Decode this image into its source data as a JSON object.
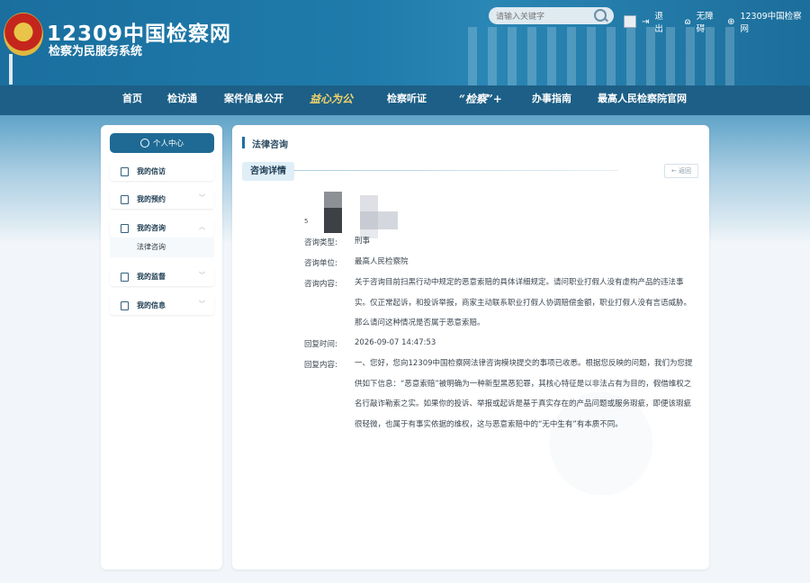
{
  "header": {
    "logo_title": "12309中国检察网",
    "logo_subtitle": "检察为民服务系统",
    "search_placeholder": "请输入关键字",
    "logout": "退出",
    "accessibility": "无障碍",
    "site_link": "12309中国检察网"
  },
  "nav": {
    "items": [
      "首页",
      "检访通",
      "案件信息公开",
      "益心为公",
      "检察听证",
      "“检察”+",
      "办事指南",
      "最高人民检察院官网"
    ]
  },
  "sidebar": {
    "personal_center": "个人中心",
    "menus": [
      "我的信访",
      "我的预约",
      "我的咨询",
      "我的监督",
      "我的信息"
    ],
    "submenu": "法律咨询"
  },
  "main": {
    "breadcrumb": "法律咨询",
    "tab": "咨询详情",
    "back": "← 返回",
    "name_fragment": "5",
    "fields": [
      {
        "label": "咨询类型:",
        "value": "刑事"
      },
      {
        "label": "咨询单位:",
        "value": "最高人民检察院"
      },
      {
        "label": "咨询内容:",
        "value": "关于咨询目前扫黑行动中规定的恶意索赔的具体详细规定。请问职业打假人没有虚构产品的违法事实。仅正常起诉，和投诉举报，商家主动联系职业打假人协调赔偿金额，职业打假人没有言语威胁。那么请问这种情况是否属于恶意索赔。"
      },
      {
        "label": "回复时间:",
        "value": "2026-09-07 14:47:53"
      },
      {
        "label": "回复内容:",
        "value": "一、您好，您向12309中国检察网法律咨询模块提交的事项已收悉。根据您反映的问题，我们为您提供如下信息：“恶意索赔”被明确为一种新型黑恶犯罪，其核心特征是以非法占有为目的，假借维权之名行敲诈勒索之实。如果你的投诉、举报或起诉是基于真实存在的产品问题或服务瑕疵，即便该瑕疵很轻微，也属于有事实依据的维权，这与恶意索赔中的“无中生有”有本质不同。"
      }
    ]
  }
}
